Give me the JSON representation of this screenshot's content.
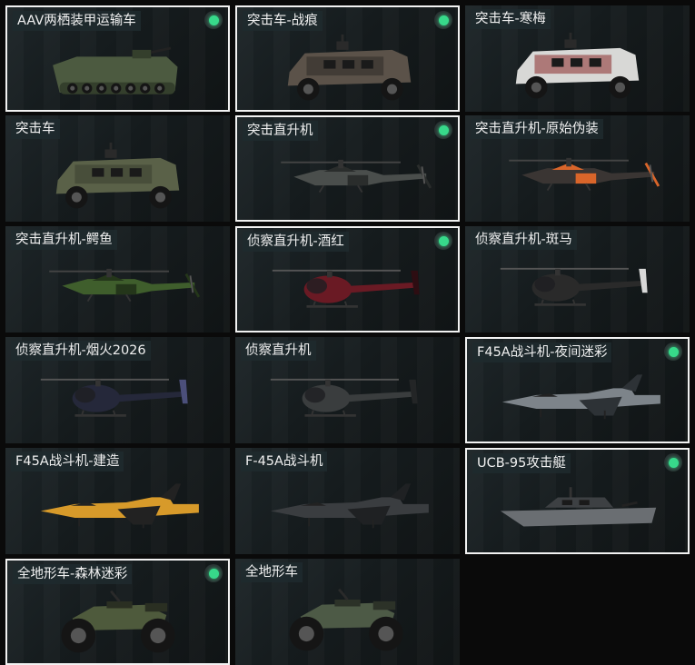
{
  "cards": [
    {
      "name": "AAV两栖装甲运输车",
      "type": "amphib",
      "colors": [
        "#4c5a40",
        "#343f2c"
      ],
      "selected": true,
      "owned": true
    },
    {
      "name": "突击车-战痕",
      "type": "truck",
      "colors": [
        "#5b5249",
        "#2e2a26"
      ],
      "selected": true,
      "owned": true
    },
    {
      "name": "突击车-寒梅",
      "type": "truck",
      "colors": [
        "#d8d8d6",
        "#8a2b2b"
      ],
      "selected": false,
      "owned": false
    },
    {
      "name": "突击车",
      "type": "truck",
      "colors": [
        "#5a6148",
        "#3a3f30"
      ],
      "selected": false,
      "owned": false
    },
    {
      "name": "突击直升机",
      "type": "apache",
      "colors": [
        "#4a4e4c",
        "#2a2d2c"
      ],
      "selected": true,
      "owned": true
    },
    {
      "name": "突击直升机-原始伪装",
      "type": "apache",
      "colors": [
        "#3a3533",
        "#d9652a"
      ],
      "selected": false,
      "owned": false
    },
    {
      "name": "突击直升机-鳄鱼",
      "type": "apache",
      "colors": [
        "#3f5e2c",
        "#24361a"
      ],
      "selected": false,
      "owned": false
    },
    {
      "name": "侦察直升机-酒红",
      "type": "littlebird",
      "colors": [
        "#6a1a24",
        "#2d0d12"
      ],
      "selected": true,
      "owned": true
    },
    {
      "name": "侦察直升机-斑马",
      "type": "littlebird",
      "colors": [
        "#2a2a2a",
        "#d8d8d8"
      ],
      "selected": false,
      "owned": false
    },
    {
      "name": "侦察直升机-烟火2026",
      "type": "littlebird",
      "colors": [
        "#25283a",
        "#4b4f7a"
      ],
      "selected": false,
      "owned": false
    },
    {
      "name": "侦察直升机",
      "type": "littlebird",
      "colors": [
        "#3a3d3e",
        "#232526"
      ],
      "selected": false,
      "owned": false
    },
    {
      "name": "F45A战斗机-夜间迷彩",
      "type": "jet",
      "colors": [
        "#7d848a",
        "#2d3236"
      ],
      "selected": true,
      "owned": true
    },
    {
      "name": "F45A战斗机-建造",
      "type": "jet",
      "colors": [
        "#d79a2a",
        "#222222"
      ],
      "selected": false,
      "owned": false
    },
    {
      "name": "F-45A战斗机",
      "type": "jet",
      "colors": [
        "#3a3d40",
        "#1f2123"
      ],
      "selected": false,
      "owned": false
    },
    {
      "name": "UCB-95攻击艇",
      "type": "boat",
      "colors": [
        "#6a6e72",
        "#3d4043"
      ],
      "selected": true,
      "owned": true
    },
    {
      "name": "全地形车-森林迷彩",
      "type": "atv",
      "colors": [
        "#4e5a3c",
        "#2a2f22"
      ],
      "selected": true,
      "owned": true
    },
    {
      "name": "全地形车",
      "type": "atv",
      "colors": [
        "#4d5a46",
        "#2c3228"
      ],
      "selected": false,
      "owned": false
    }
  ]
}
